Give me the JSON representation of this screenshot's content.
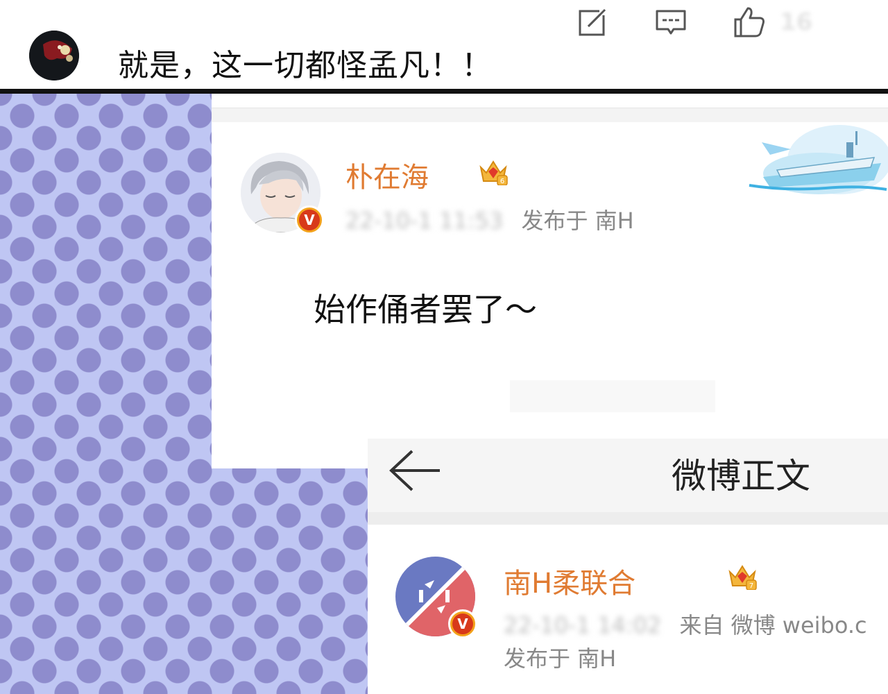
{
  "top_comment": {
    "text": "就是，这一切都怪孟凡！！",
    "like_count": "16",
    "icons": [
      "share-icon",
      "comment-icon",
      "like-icon"
    ]
  },
  "post1": {
    "username": "朴在海",
    "verified_mark": "V",
    "timestamp": "22-10-1 11:53",
    "published_from": "发布于 南H",
    "body": "始作俑者罢了～",
    "badge_level": "6"
  },
  "detail_page": {
    "title": "微博正文",
    "back_icon": "back-arrow-icon"
  },
  "post2": {
    "username": "南H柔联合",
    "verified_mark": "V",
    "timestamp": "22-10-1 14:02",
    "source": "来自 微博 weibo.c",
    "published_from": "发布于 南H",
    "badge_level": "7"
  },
  "colors": {
    "username": "#e07b32",
    "dot_bg": "#bfc6f3",
    "dot": "#8e8ccd",
    "verified": "#d8391a"
  }
}
